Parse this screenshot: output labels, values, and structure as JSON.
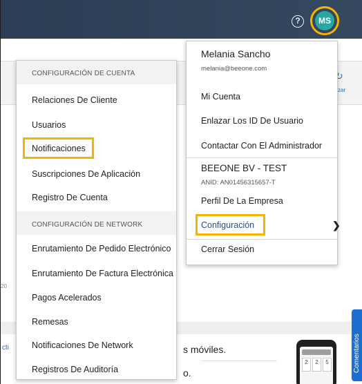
{
  "header": {
    "help_icon": "help-circle-icon",
    "avatar_initials": "MS"
  },
  "background": {
    "refresh_label": "alizar",
    "link_text": "cti",
    "mark_text": "20",
    "line1": "s móviles.",
    "line2": "o.",
    "phone_cards": [
      "2",
      "2",
      "5"
    ],
    "feedback_label": "Comentarios"
  },
  "account_menu": {
    "section1": "CONFIGURACIÓN DE CUENTA",
    "items1": [
      "Relaciones De Cliente",
      "Usuarios",
      "Notificaciones",
      "Suscripciones De Aplicación",
      "Registro De Cuenta"
    ],
    "section2": "CONFIGURACIÓN DE NETWORK",
    "items2": [
      "Enrutamiento De Pedido Electrónico",
      "Enrutamiento De Factura Electrónica",
      "Pagos Acelerados",
      "Remesas",
      "Notificaciones De Network",
      "Registros De Auditoría"
    ]
  },
  "user_menu": {
    "name": "Melania Sancho",
    "email": "melania@beeone.com",
    "links": [
      "Mi Cuenta",
      "Enlazar Los ID De Usuario",
      "Contactar Con El Administrador"
    ],
    "company": "BEEONE BV - TEST",
    "anid": "ANID: AN01456315657-T",
    "company_profile": "Perfil De La Empresa",
    "settings": "Configuración",
    "logout": "Cerrar Sesión"
  },
  "colors": {
    "highlight": "#f4b400",
    "topbar": "#2c3e55",
    "avatar": "#2aa7a1",
    "feedback": "#1a6fd1"
  }
}
